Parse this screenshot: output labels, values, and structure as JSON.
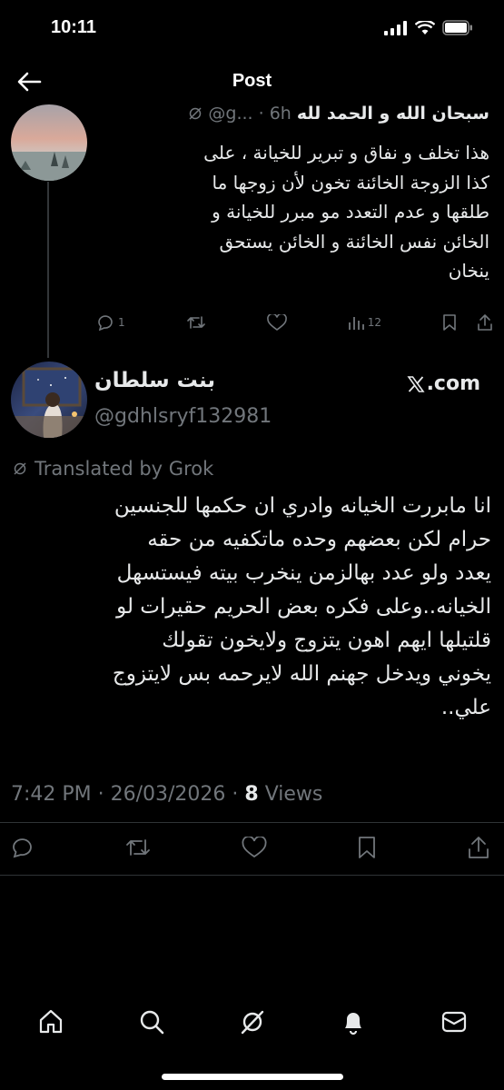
{
  "status_bar": {
    "time": "10:11"
  },
  "header": {
    "title": "Post"
  },
  "parent_post": {
    "display_name": "سبحان الله و الحمد لله",
    "handle": "@g...",
    "time": "6h",
    "text_lines": [
      "هذا تخلف و نفاق و تبرير للخيانة ، على",
      "كذا الزوجة الخائنة تخون لأن زوجها ما",
      "طلقها و عدم التعدد مو مبرر للخيانة و",
      "الخائن نفس الخائنة و الخائن يستحق",
      "ينخان"
    ],
    "replies": "1",
    "views": "12"
  },
  "main_post": {
    "display_name": "بنت سلطان",
    "handle": "@gdhlsryf132981",
    "source": ".com",
    "translated_label": "Translated by Grok",
    "text_lines": [
      "انا مابررت الخيانه وادري ان حكمها للجنسين",
      "حرام لكن بعضهم وحده ماتكفيه من حقه",
      "يعدد ولو عدد بهالزمن ينخرب بيته فيستسهل",
      "الخيانه..وعلى فكره بعض الحريم حقيرات لو",
      "قلتيلها ايهم اهون يتزوج ولايخون تقولك",
      "يخوني ويدخل جهنم الله لايرحمه بس لايتزوج",
      "علي.."
    ],
    "timestamp": "7:42 PM · 26/03/2026 · ",
    "views_count": "8",
    "views_label": " Views"
  }
}
